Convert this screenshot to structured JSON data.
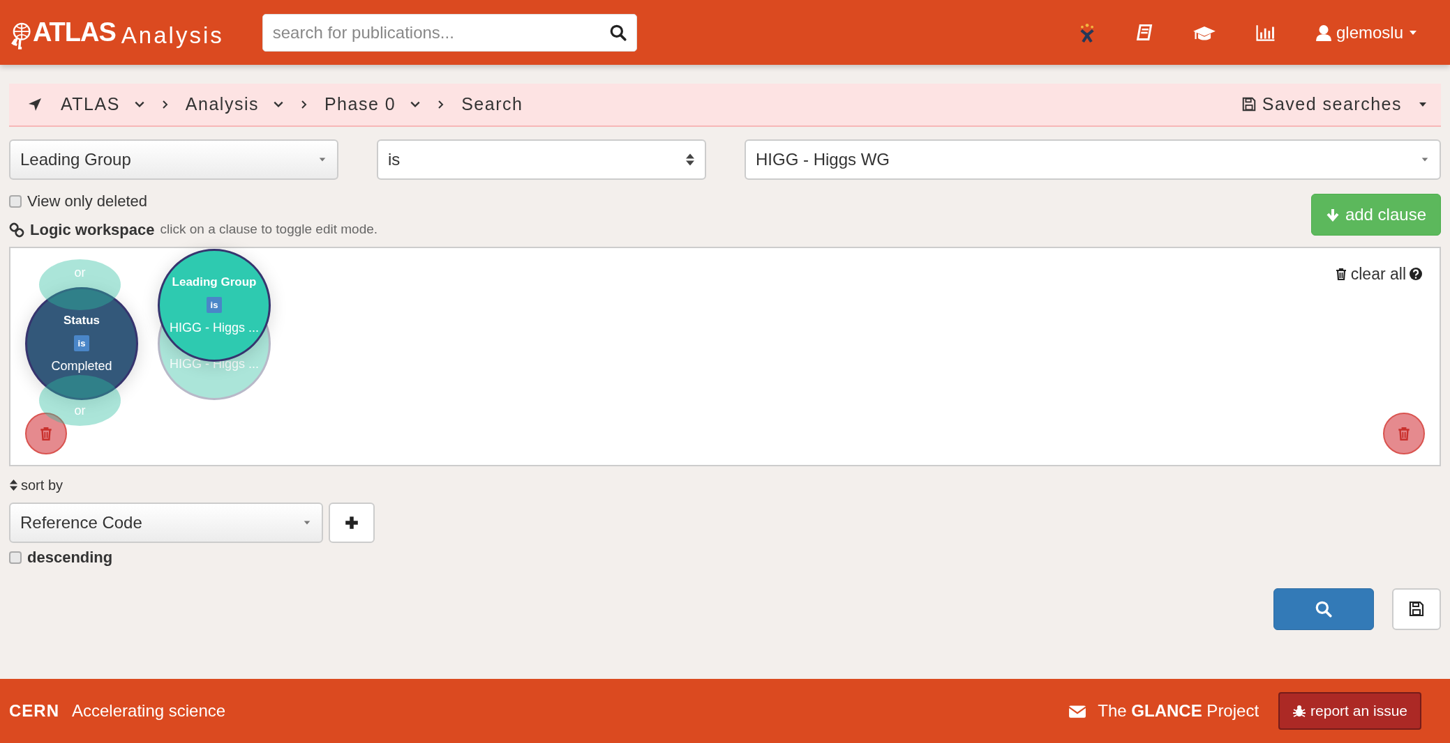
{
  "header": {
    "brand": "ATLAS",
    "app": "Analysis",
    "search": {
      "placeholder": "search for publications..."
    },
    "user": "glemoslu"
  },
  "breadcrumb": {
    "items": [
      {
        "label": "ATLAS",
        "has_menu": true
      },
      {
        "label": "Analysis",
        "has_menu": true
      },
      {
        "label": "Phase 0",
        "has_menu": true
      },
      {
        "label": "Search",
        "has_menu": false
      }
    ],
    "saved_searches": "Saved searches"
  },
  "filter": {
    "field": "Leading Group",
    "operator": "is",
    "value": "HIGG - Higgs WG"
  },
  "view_only_deleted": {
    "label": "View only deleted",
    "checked": false
  },
  "add_clause": "add clause",
  "workspace": {
    "title": "Logic workspace",
    "hint": "click on a clause to toggle edit mode.",
    "clear_all": "clear all",
    "clauses": [
      {
        "kind": "clause",
        "field": "Status",
        "operator": "is",
        "value": "Completed",
        "color": "#33587a",
        "connectors": [
          "or",
          "or"
        ]
      },
      {
        "kind": "clause",
        "field": "Leading Group",
        "operator": "is",
        "value": "HIGG - Higgs ...",
        "color": "#2ecab0"
      },
      {
        "kind": "ghost",
        "value": "HIGG - Higgs ..."
      }
    ]
  },
  "sort": {
    "label": "sort by",
    "field": "Reference Code",
    "descending": {
      "label": "descending",
      "checked": false
    }
  },
  "footer": {
    "org": "CERN",
    "tagline": "Accelerating science",
    "project": "The **GLANCE** Project",
    "report": "report an issue"
  }
}
